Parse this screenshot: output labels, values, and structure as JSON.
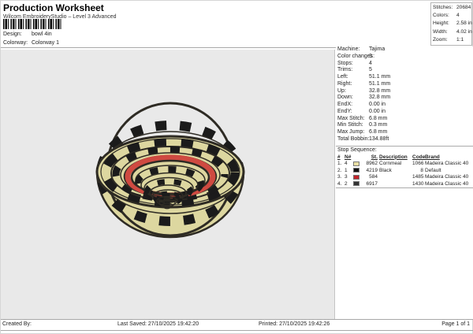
{
  "header": {
    "title": "Production Worksheet",
    "subtitle": "Wilcom EmbroideryStudio – Level 3 Advanced",
    "barcode_icon": "barcode",
    "design_label": "Design:",
    "design_value": "bowl 4in",
    "colorway_label": "Colorway:",
    "colorway_value": "Colorway 1"
  },
  "stats": {
    "rows": [
      {
        "label": "Stitches:",
        "value": "20684"
      },
      {
        "label": "Colors:",
        "value": "4"
      },
      {
        "label": "Height:",
        "value": "2.58 in"
      },
      {
        "label": "Width:",
        "value": "4.02 in"
      },
      {
        "label": "Zoom:",
        "value": "1:1"
      }
    ]
  },
  "machine": {
    "rows": [
      {
        "label": "Machine:",
        "value": "Tajima"
      },
      {
        "label": "Color changes:",
        "value": "3"
      },
      {
        "label": "Stops:",
        "value": "4"
      },
      {
        "label": "Trims:",
        "value": "5"
      },
      {
        "label": "Left:",
        "value": "51.1 mm"
      },
      {
        "label": "Right:",
        "value": "51.1 mm"
      },
      {
        "label": "Up:",
        "value": "32.8 mm"
      },
      {
        "label": "Down:",
        "value": "32.8 mm"
      },
      {
        "label": "EndX:",
        "value": "0.00 in"
      },
      {
        "label": "EndY:",
        "value": "0.00 in"
      },
      {
        "label": "Max Stitch:",
        "value": "6.8 mm"
      },
      {
        "label": "Min Stitch:",
        "value": "0.3 mm"
      },
      {
        "label": "Max Jump:",
        "value": "6.8 mm"
      },
      {
        "label": "Total Bobbin:",
        "value": "134.88ft"
      }
    ]
  },
  "stop_sequence": {
    "title": "Stop Sequence:",
    "headers": [
      "#",
      "N#",
      "St.",
      "Description",
      "Code",
      "Brand"
    ],
    "rows": [
      {
        "num": "1.",
        "n": "4",
        "color": "#e9dfa4",
        "st": "8962",
        "desc": "Cornmeal",
        "code": "1066",
        "brand": "Madeira Classic 40"
      },
      {
        "num": "2.",
        "n": "1",
        "color": "#111111",
        "st": "4219",
        "desc": "Black",
        "code": "8",
        "brand": "Default"
      },
      {
        "num": "3.",
        "n": "3",
        "color": "#c2232a",
        "st": "584",
        "desc": "",
        "code": "1485",
        "brand": "Madeira Classic 40"
      },
      {
        "num": "4.",
        "n": "2",
        "color": "#333333",
        "st": "6917",
        "desc": "",
        "code": "1430",
        "brand": "Madeira Classic 40"
      }
    ]
  },
  "design": {
    "name": "bowl 4in embroidery preview",
    "colors": {
      "cream": "#ddd7a0",
      "black": "#1b1b1b",
      "dark": "#2e2b24",
      "red": "#cf4a41",
      "canvas": "#e9e9e9"
    }
  },
  "footer": {
    "created_by": "Created By:",
    "last_saved": "Last Saved: 27/10/2025 19:42:20",
    "printed": "Printed: 27/10/2025 19:42:26",
    "page": "Page 1 of 1"
  }
}
